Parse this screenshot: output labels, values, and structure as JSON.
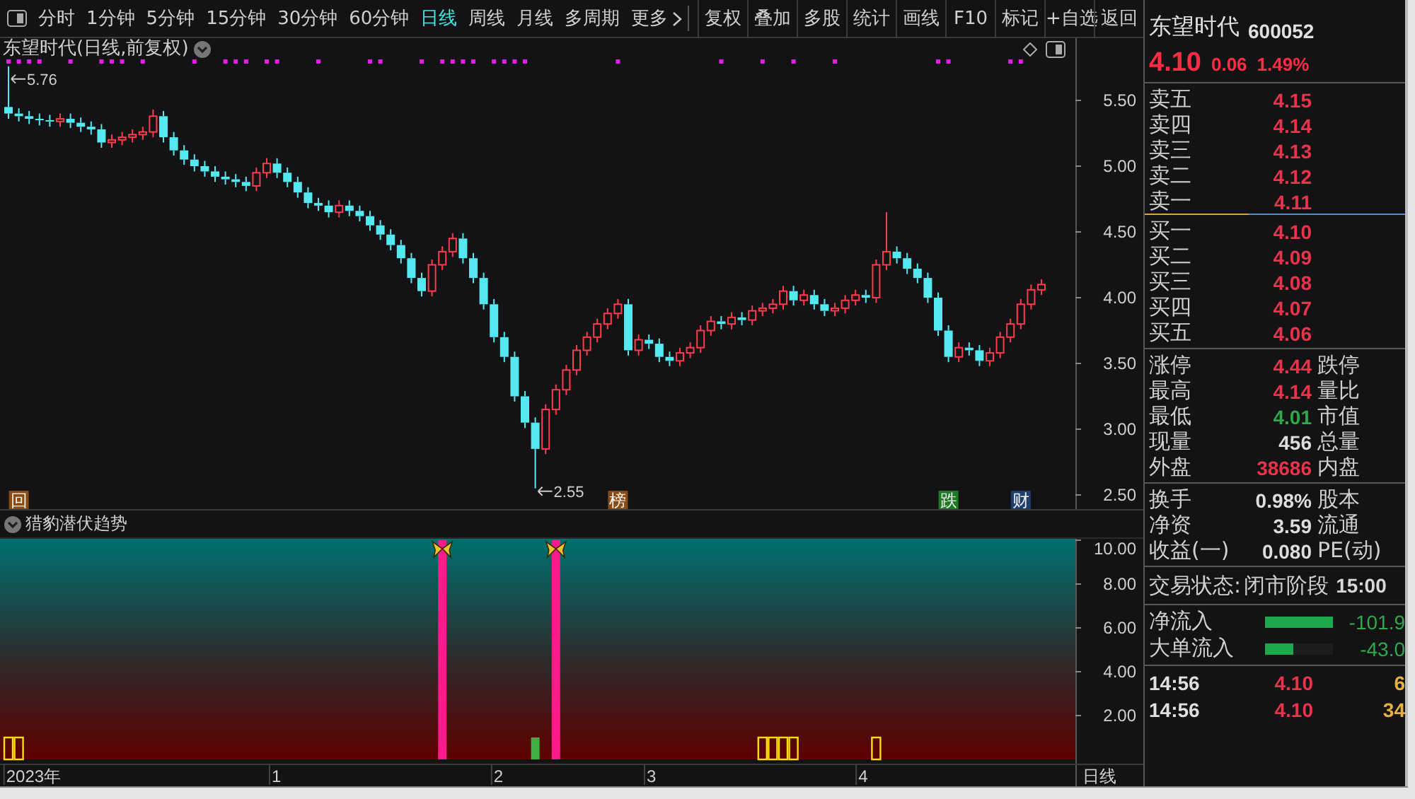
{
  "toolbar": {
    "periods": [
      {
        "label": "分时",
        "selected": false
      },
      {
        "label": "1分钟",
        "selected": false
      },
      {
        "label": "5分钟",
        "selected": false
      },
      {
        "label": "15分钟",
        "selected": false
      },
      {
        "label": "30分钟",
        "selected": false
      },
      {
        "label": "60分钟",
        "selected": false
      },
      {
        "label": "日线",
        "selected": true
      },
      {
        "label": "周线",
        "selected": false
      },
      {
        "label": "月线",
        "selected": false
      },
      {
        "label": "多周期",
        "selected": false
      },
      {
        "label": "更多",
        "selected": false
      }
    ],
    "buttons": [
      "复权",
      "叠加",
      "多股",
      "统计",
      "画线",
      "F10",
      "标记",
      "+自选",
      "返回"
    ]
  },
  "main_chart": {
    "title": "东望时代(日线,前复权)",
    "axis_labels": [
      "5.50",
      "5.00",
      "4.50",
      "4.00",
      "3.50",
      "3.00",
      "2.50"
    ],
    "price_marks": [
      "5.76",
      "2.55"
    ],
    "event_badges": [
      {
        "label": "回",
        "color": "#8a4a14"
      },
      {
        "label": "榜",
        "color": "#8a4a14"
      },
      {
        "label": "跌",
        "color": "#1f7a24"
      },
      {
        "label": "财",
        "color": "#1c3f70"
      }
    ]
  },
  "indicator": {
    "title": "猎豹潜伏趋势",
    "axis_labels": [
      "10.00",
      "8.00",
      "6.00",
      "4.00",
      "2.00"
    ]
  },
  "date_labels": [
    "2023年",
    "1",
    "2",
    "3",
    "4"
  ],
  "period_label": "日线",
  "quote": {
    "name": "东望时代",
    "code": "600052",
    "price": "4.10",
    "change": "0.06",
    "change_pct": "1.49%"
  },
  "order_book": {
    "asks": [
      {
        "label": "卖五",
        "price": "4.15"
      },
      {
        "label": "卖四",
        "price": "4.14"
      },
      {
        "label": "卖三",
        "price": "4.13"
      },
      {
        "label": "卖二",
        "price": "4.12"
      },
      {
        "label": "卖一",
        "price": "4.11"
      }
    ],
    "bids": [
      {
        "label": "买一",
        "price": "4.10"
      },
      {
        "label": "买二",
        "price": "4.09"
      },
      {
        "label": "买三",
        "price": "4.08"
      },
      {
        "label": "买四",
        "price": "4.07"
      },
      {
        "label": "买五",
        "price": "4.06"
      }
    ]
  },
  "stats": [
    {
      "label": "涨停",
      "value": "4.44",
      "color": "#e8344a",
      "label2": "跌停"
    },
    {
      "label": "最高",
      "value": "4.14",
      "color": "#e8344a",
      "label2": "量比"
    },
    {
      "label": "最低",
      "value": "4.01",
      "color": "#2ea84a",
      "label2": "市值"
    },
    {
      "label": "现量",
      "value": "456",
      "color": "#dddddd",
      "label2": "总量"
    },
    {
      "label": "外盘",
      "value": "38686",
      "color": "#e8344a",
      "label2": "内盘"
    }
  ],
  "finance": [
    {
      "label": "换手",
      "value": "0.98%",
      "label2": "股本"
    },
    {
      "label": "净资",
      "value": "3.59",
      "label2": "流通"
    },
    {
      "label": "收益(一)",
      "value": "0.080",
      "label2": "PE(动)"
    }
  ],
  "trade_status": {
    "label": "交易状态:",
    "value": "闭市阶段",
    "time": "15:00"
  },
  "fund_flow": [
    {
      "label": "净流入",
      "level": 1,
      "value": "-101.9"
    },
    {
      "label": "大单流入",
      "level": 0.42,
      "value": "-43.0"
    }
  ],
  "ticks": [
    {
      "time": "14:56",
      "price": "4.10",
      "volume": "6"
    },
    {
      "time": "14:56",
      "price": "4.10",
      "volume": "34"
    }
  ]
}
